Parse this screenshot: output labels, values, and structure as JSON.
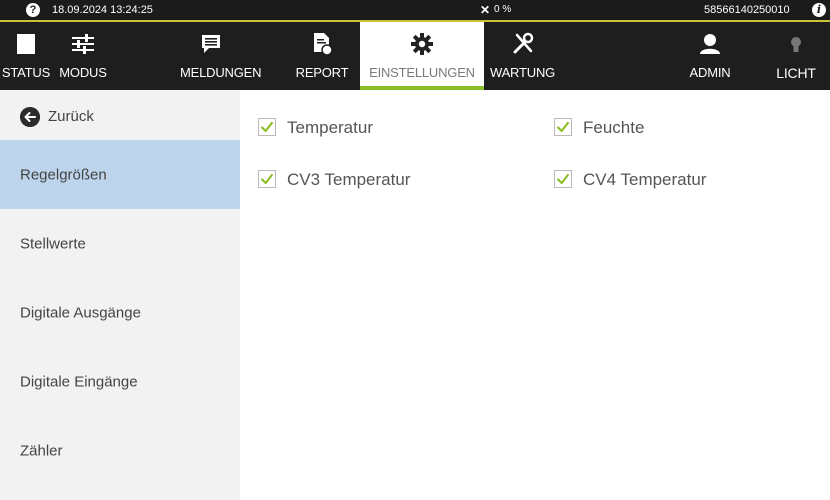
{
  "statusbar": {
    "help_symbol": "?",
    "datetime": "18.09.2024 13:24:25",
    "tool_symbol": "✕",
    "percent": "0 %",
    "serial": "58566140250010",
    "info_symbol": "i"
  },
  "nav": {
    "items": [
      {
        "label": "STATUS",
        "icon": "square-icon"
      },
      {
        "label": "MODUS",
        "icon": "sliders-icon"
      },
      {
        "label": "MELDUNGEN",
        "icon": "message-icon"
      },
      {
        "label": "REPORT",
        "icon": "report-icon"
      },
      {
        "label": "EINSTELLUNGEN",
        "icon": "gear-icon"
      },
      {
        "label": "WARTUNG",
        "icon": "tools-icon"
      },
      {
        "label": "ADMIN",
        "icon": "user-icon"
      },
      {
        "label": "LICHT",
        "icon": "bulb-icon"
      }
    ],
    "active": "EINSTELLUNGEN"
  },
  "sidebar": {
    "back_label": "Zurück",
    "items": [
      {
        "label": "Regelgrößen"
      },
      {
        "label": "Stellwerte"
      },
      {
        "label": "Digitale Ausgänge"
      },
      {
        "label": "Digitale Eingänge"
      },
      {
        "label": "Zähler"
      }
    ]
  },
  "content": {
    "checkboxes": [
      {
        "label": "Temperatur",
        "checked": true
      },
      {
        "label": "Feuchte",
        "checked": true
      },
      {
        "label": "CV3 Temperatur",
        "checked": true
      },
      {
        "label": "CV4 Temperatur",
        "checked": true
      }
    ]
  },
  "colors": {
    "accent_green": "#8cbf26",
    "status_yellow": "#c7c43a",
    "nav_bg": "#1e1e1e",
    "sidebar_active": "#bdd5ec"
  }
}
